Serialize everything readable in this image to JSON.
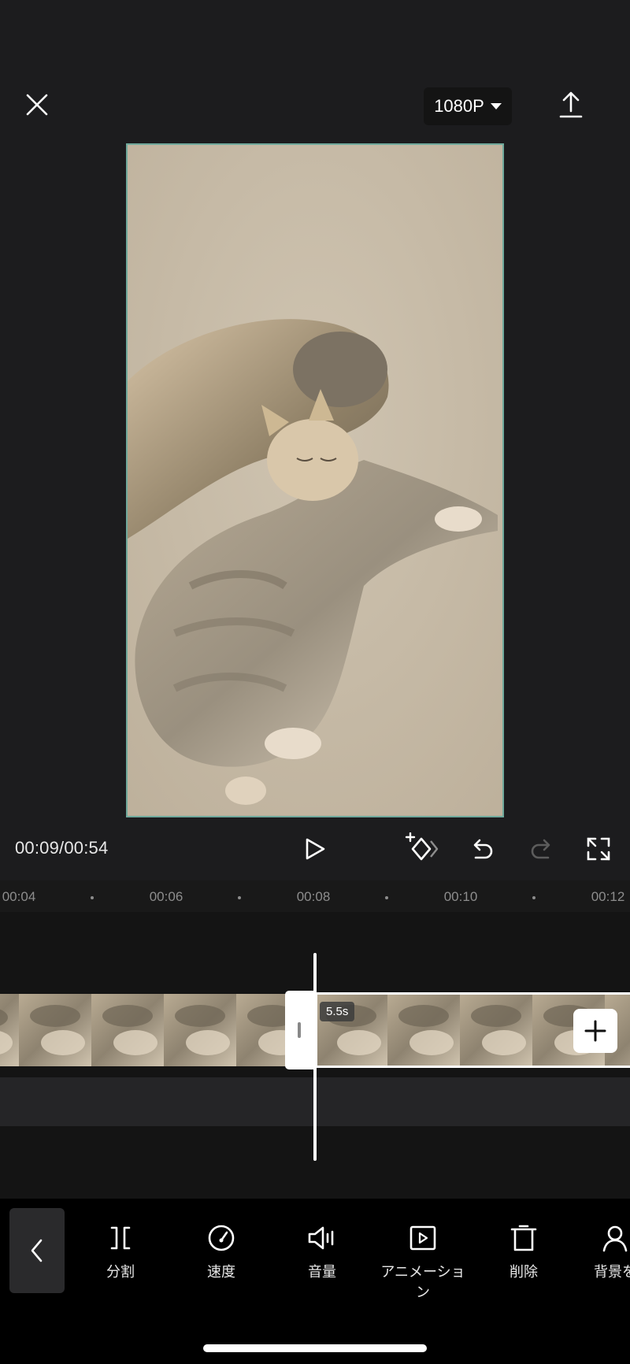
{
  "header": {
    "resolution_label": "1080P"
  },
  "playback": {
    "time_display": "00:09/00:54"
  },
  "ruler": {
    "labels": [
      "00:04",
      "00:06",
      "00:08",
      "00:10",
      "00:12"
    ]
  },
  "timeline": {
    "clip_duration": "5.5s"
  },
  "toolbar": {
    "items": [
      {
        "label": "分割",
        "icon": "split-icon"
      },
      {
        "label": "速度",
        "icon": "speed-icon"
      },
      {
        "label": "音量",
        "icon": "volume-icon"
      },
      {
        "label": "アニメーション",
        "icon": "animation-icon"
      },
      {
        "label": "削除",
        "icon": "delete-icon"
      },
      {
        "label": "背景を",
        "icon": "person-icon"
      }
    ]
  },
  "colors": {
    "background": "#1c1c1e",
    "preview_border": "#6fa99c",
    "toolbar": "#000000"
  }
}
